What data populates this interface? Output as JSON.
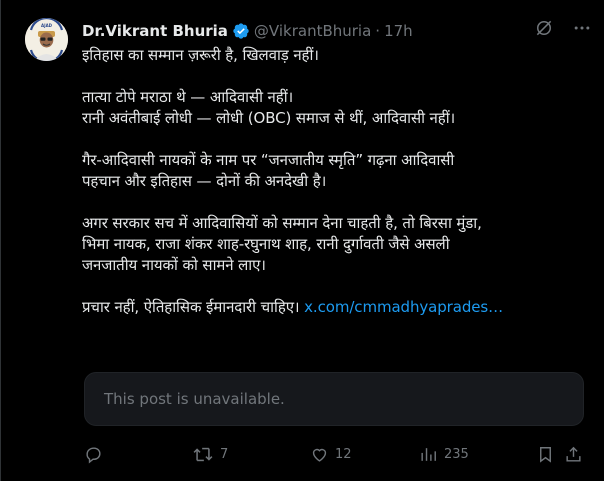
{
  "author": {
    "display_name": "Dr.Vikrant Bhuria",
    "handle": "@VikrantBhuria",
    "separator": "·",
    "time": "17h",
    "avatar_icon": "avatar-portrait"
  },
  "tweet": {
    "paragraphs": [
      [
        "इतिहास का सम्मान ज़रूरी है, खिलवाड़ नहीं।"
      ],
      [
        "तात्या टोपे मराठा थे — आदिवासी नहीं।",
        "रानी अवंतीबाई लोधी — लोधी (OBC) समाज से थीं, आदिवासी नहीं।"
      ],
      [
        "गैर-आदिवासी नायकों के नाम पर “जनजातीय स्मृति” गढ़ना आदिवासी",
        "पहचान और इतिहास — दोनों की अनदेखी है।"
      ],
      [
        "अगर सरकार सच में आदिवासियों को सम्मान देना चाहती है, तो बिरसा मुंडा,",
        "भिमा नायक, राजा शंकर शाह-रघुनाथ शाह, रानी दुर्गावती जैसे असली",
        "जनजातीय नायकों को सामने लाए।"
      ]
    ],
    "final_text": "प्रचार नहीं, ऐतिहासिक ईमानदारी चाहिए।",
    "link_text": "x.com/cmmadhyaprades…"
  },
  "quote": {
    "unavailable_text": "This post is unavailable."
  },
  "actions": {
    "reply_count": "",
    "retweet_count": "7",
    "like_count": "12",
    "views_count": "235",
    "bookmark_count": "",
    "share_count": ""
  },
  "colors": {
    "background": "#000000",
    "text": "#e7e9ea",
    "secondary": "#71767b",
    "link": "#1d9bf0",
    "verified": "#1d9bf0",
    "quote_bg": "#16181c"
  }
}
